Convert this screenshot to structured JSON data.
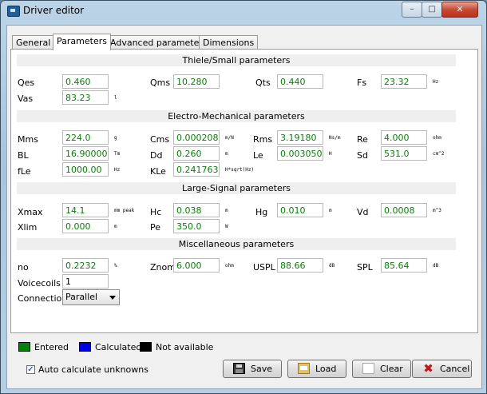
{
  "window": {
    "title": "Driver editor",
    "minimize": "–",
    "maximize": "□",
    "close": "✕"
  },
  "tabs": [
    "General",
    "Parameters",
    "Advanced parameters",
    "Dimensions"
  ],
  "sections": {
    "ts": "Thiele/Small parameters",
    "em": "Electro-Mechanical parameters",
    "ls": "Large-Signal parameters",
    "misc": "Miscellaneous parameters"
  },
  "params": {
    "qes": {
      "label": "Qes",
      "value": "0.460",
      "unit": ""
    },
    "qms": {
      "label": "Qms",
      "value": "10.280",
      "unit": ""
    },
    "qts": {
      "label": "Qts",
      "value": "0.440",
      "unit": ""
    },
    "fs": {
      "label": "Fs",
      "value": "23.32",
      "unit": "Hz"
    },
    "vas": {
      "label": "Vas",
      "value": "83.23",
      "unit": "l"
    },
    "mms": {
      "label": "Mms",
      "value": "224.0",
      "unit": "g"
    },
    "cms": {
      "label": "Cms",
      "value": "0.0002080",
      "unit": "m/N"
    },
    "rms": {
      "label": "Rms",
      "value": "3.19180",
      "unit": "Ns/m"
    },
    "re": {
      "label": "Re",
      "value": "4.000",
      "unit": "ohm"
    },
    "bl": {
      "label": "BL",
      "value": "16.90000",
      "unit": "Tm"
    },
    "dd": {
      "label": "Dd",
      "value": "0.260",
      "unit": "m"
    },
    "le": {
      "label": "Le",
      "value": "0.003050",
      "unit": "H"
    },
    "sd": {
      "label": "Sd",
      "value": "531.0",
      "unit": "cm^2"
    },
    "fle": {
      "label": "fLe",
      "value": "1000.00",
      "unit": "Hz"
    },
    "kle": {
      "label": "KLe",
      "value": "0.241763",
      "unit": "H*sqrt(Hz)"
    },
    "xmax": {
      "label": "Xmax",
      "value": "14.1",
      "unit": "mm peak"
    },
    "hc": {
      "label": "Hc",
      "value": "0.038",
      "unit": "m"
    },
    "hg": {
      "label": "Hg",
      "value": "0.010",
      "unit": "m"
    },
    "vd": {
      "label": "Vd",
      "value": "0.0008",
      "unit": "m^3"
    },
    "xlim": {
      "label": "Xlim",
      "value": "0.000",
      "unit": "m"
    },
    "pe": {
      "label": "Pe",
      "value": "350.0",
      "unit": "W"
    },
    "no": {
      "label": "no",
      "value": "0.2232",
      "unit": "%"
    },
    "znom": {
      "label": "Znom",
      "value": "6.000",
      "unit": "ohm"
    },
    "uspl": {
      "label": "USPL",
      "value": "88.66",
      "unit": "dB"
    },
    "spl": {
      "label": "SPL",
      "value": "85.64",
      "unit": "dB"
    },
    "voicecoils": {
      "label": "Voicecoils",
      "value": "1"
    },
    "connection": {
      "label": "Connection",
      "value": "Parallel"
    }
  },
  "legend": {
    "entered": "Entered",
    "calculated": "Calculated",
    "na": "Not available",
    "colors": {
      "entered": "#0a7d0a",
      "calculated": "#0000e0",
      "na": "#000000"
    }
  },
  "auto_calc": {
    "label": "Auto calculate unknowns",
    "checked": "✓"
  },
  "buttons": {
    "save": "Save",
    "load": "Load",
    "clear": "Clear",
    "cancel": "Cancel"
  }
}
